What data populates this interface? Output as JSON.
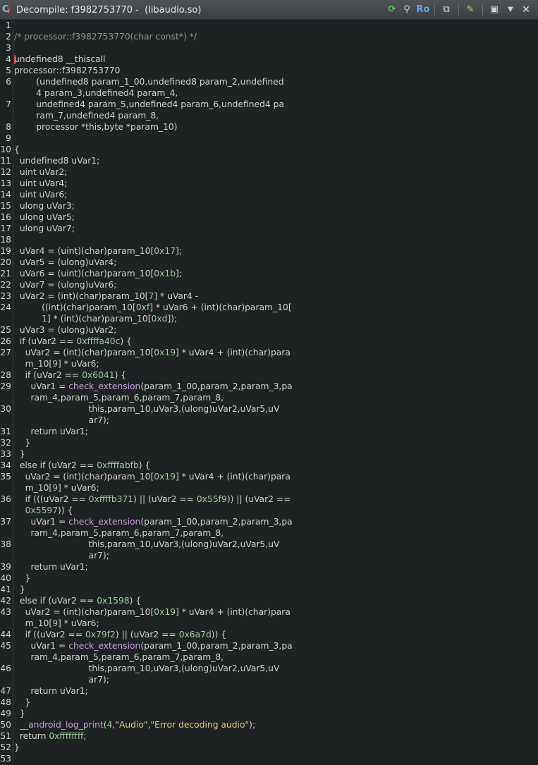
{
  "window": {
    "title": "Decompile: f3982753770 -  (libaudio.so)",
    "icon_name": "decompiler-icon",
    "accent": "#8fb6e8"
  },
  "toolbar": {
    "buttons": [
      {
        "name": "refresh-icon",
        "glyph": "⟳",
        "color": "#5fc05f"
      },
      {
        "name": "graph-icon",
        "glyph": "⚲",
        "color": "#d0d0d0"
      },
      {
        "name": "read-only-button",
        "glyph": "Ro",
        "color": "#6aa0e8"
      },
      {
        "name": "copy-icon",
        "glyph": "⧉",
        "color": "#e0e0e0"
      },
      {
        "name": "edit-icon",
        "glyph": "✎",
        "color": "#e0c060"
      },
      {
        "name": "snapshot-icon",
        "glyph": "▣",
        "color": "#cfcfcf"
      },
      {
        "name": "menu-dropdown-icon",
        "glyph": "▼",
        "color": "#cfcfcf"
      },
      {
        "name": "close-icon",
        "glyph": "✕",
        "color": "#e0e0e0"
      }
    ]
  },
  "code_lines": [
    {
      "n": "1",
      "segs": []
    },
    {
      "n": "2",
      "segs": [
        [
          "cm",
          "/* processor::f3982753770(char const*) */"
        ]
      ]
    },
    {
      "n": "3",
      "segs": []
    },
    {
      "n": "4",
      "segs": [
        [
          "t",
          "undefined8 __thiscall"
        ]
      ],
      "cursor": true
    },
    {
      "n": "5",
      "segs": [
        [
          "t",
          "processor::f3982753770"
        ]
      ]
    },
    {
      "n": "6",
      "segs": [
        [
          "t",
          "        (undefined8 param_1_00,undefined8 param_2,undefined"
        ]
      ]
    },
    {
      "n": "",
      "segs": [
        [
          "t",
          "        4 param_3,undefined4 param_4,"
        ]
      ]
    },
    {
      "n": "7",
      "segs": [
        [
          "t",
          "        undefined4 param_5,undefined4 param_6,undefined4 pa"
        ]
      ]
    },
    {
      "n": "",
      "segs": [
        [
          "t",
          "        ram_7,undefined4 param_8,"
        ]
      ]
    },
    {
      "n": "8",
      "segs": [
        [
          "t",
          "        processor *this,byte *param_10)"
        ]
      ]
    },
    {
      "n": "9",
      "segs": []
    },
    {
      "n": "10",
      "segs": [
        [
          "t",
          "{"
        ]
      ]
    },
    {
      "n": "11",
      "segs": [
        [
          "t",
          "  undefined8 uVar1;"
        ]
      ]
    },
    {
      "n": "12",
      "segs": [
        [
          "t",
          "  uint uVar2;"
        ]
      ]
    },
    {
      "n": "13",
      "segs": [
        [
          "t",
          "  uint uVar4;"
        ]
      ]
    },
    {
      "n": "14",
      "segs": [
        [
          "t",
          "  uint uVar6;"
        ]
      ]
    },
    {
      "n": "15",
      "segs": [
        [
          "t",
          "  ulong uVar3;"
        ]
      ]
    },
    {
      "n": "16",
      "segs": [
        [
          "t",
          "  ulong uVar5;"
        ]
      ]
    },
    {
      "n": "17",
      "segs": [
        [
          "t",
          "  ulong uVar7;"
        ]
      ]
    },
    {
      "n": "18",
      "segs": []
    },
    {
      "n": "19",
      "segs": [
        [
          "t",
          "  uVar4 = (uint)(char)param_10["
        ],
        [
          "num",
          "0x17"
        ],
        [
          "t",
          "];"
        ]
      ]
    },
    {
      "n": "20",
      "segs": [
        [
          "t",
          "  uVar5 = (ulong)uVar4;"
        ]
      ]
    },
    {
      "n": "21",
      "segs": [
        [
          "t",
          "  uVar6 = (uint)(char)param_10["
        ],
        [
          "num",
          "0x1b"
        ],
        [
          "t",
          "];"
        ]
      ]
    },
    {
      "n": "22",
      "segs": [
        [
          "t",
          "  uVar7 = (ulong)uVar6;"
        ]
      ]
    },
    {
      "n": "23",
      "segs": [
        [
          "t",
          "  uVar2 = (int)(char)param_10["
        ],
        [
          "num",
          "7"
        ],
        [
          "t",
          "] * uVar4 -"
        ]
      ]
    },
    {
      "n": "24",
      "segs": [
        [
          "t",
          "          ((int)(char)param_10["
        ],
        [
          "num",
          "0xf"
        ],
        [
          "t",
          "] * uVar6 + (int)(char)param_10["
        ]
      ]
    },
    {
      "n": "",
      "segs": [
        [
          "t",
          "          "
        ],
        [
          "num",
          "1"
        ],
        [
          "t",
          "] * (int)(char)param_10["
        ],
        [
          "num",
          "0xd"
        ],
        [
          "t",
          "]);"
        ]
      ]
    },
    {
      "n": "25",
      "segs": [
        [
          "t",
          "  uVar3 = (ulong)uVar2;"
        ]
      ]
    },
    {
      "n": "26",
      "segs": [
        [
          "t",
          "  if (uVar2 == "
        ],
        [
          "num",
          "0xffffa40c"
        ],
        [
          "t",
          ") {"
        ]
      ]
    },
    {
      "n": "27",
      "segs": [
        [
          "t",
          "    uVar2 = (int)(char)param_10["
        ],
        [
          "num",
          "0x19"
        ],
        [
          "t",
          "] * uVar4 + (int)(char)para"
        ]
      ]
    },
    {
      "n": "",
      "segs": [
        [
          "t",
          "    m_10["
        ],
        [
          "num",
          "9"
        ],
        [
          "t",
          "] * uVar6;"
        ]
      ]
    },
    {
      "n": "28",
      "segs": [
        [
          "t",
          "    if (uVar2 == "
        ],
        [
          "num",
          "0x6041"
        ],
        [
          "t",
          ") {"
        ]
      ]
    },
    {
      "n": "29",
      "segs": [
        [
          "t",
          "      uVar1 = "
        ],
        [
          "fn",
          "check_extension"
        ],
        [
          "t",
          "(param_1_00,param_2,param_3,pa"
        ]
      ]
    },
    {
      "n": "",
      "segs": [
        [
          "t",
          "      ram_4,param_5,param_6,param_7,param_8,"
        ]
      ]
    },
    {
      "n": "30",
      "segs": [
        [
          "t",
          "                           this,param_10,uVar3,(ulong)uVar2,uVar5,uV"
        ]
      ]
    },
    {
      "n": "",
      "segs": [
        [
          "t",
          "                           ar7);"
        ]
      ]
    },
    {
      "n": "31",
      "segs": [
        [
          "t",
          "      return uVar1;"
        ]
      ]
    },
    {
      "n": "32",
      "segs": [
        [
          "t",
          "    }"
        ]
      ]
    },
    {
      "n": "33",
      "segs": [
        [
          "t",
          "  }"
        ]
      ]
    },
    {
      "n": "34",
      "segs": [
        [
          "t",
          "  else if (uVar2 == "
        ],
        [
          "num",
          "0xffffabfb"
        ],
        [
          "t",
          ") {"
        ]
      ]
    },
    {
      "n": "35",
      "segs": [
        [
          "t",
          "    uVar2 = (int)(char)param_10["
        ],
        [
          "num",
          "0x19"
        ],
        [
          "t",
          "] * uVar4 + (int)(char)para"
        ]
      ]
    },
    {
      "n": "",
      "segs": [
        [
          "t",
          "    m_10["
        ],
        [
          "num",
          "9"
        ],
        [
          "t",
          "] * uVar6;"
        ]
      ]
    },
    {
      "n": "36",
      "segs": [
        [
          "t",
          "    if (((uVar2 == "
        ],
        [
          "num",
          "0xffffb371"
        ],
        [
          "t",
          ") || (uVar2 == "
        ],
        [
          "num",
          "0x55f9"
        ],
        [
          "t",
          ")) || (uVar2 =="
        ]
      ]
    },
    {
      "n": "",
      "segs": [
        [
          "t",
          "    "
        ],
        [
          "num",
          "0x5597"
        ],
        [
          "t",
          ")) {"
        ]
      ]
    },
    {
      "n": "37",
      "segs": [
        [
          "t",
          "      uVar1 = "
        ],
        [
          "fn",
          "check_extension"
        ],
        [
          "t",
          "(param_1_00,param_2,param_3,pa"
        ]
      ]
    },
    {
      "n": "",
      "segs": [
        [
          "t",
          "      ram_4,param_5,param_6,param_7,param_8,"
        ]
      ]
    },
    {
      "n": "38",
      "segs": [
        [
          "t",
          "                           this,param_10,uVar3,(ulong)uVar2,uVar5,uV"
        ]
      ]
    },
    {
      "n": "",
      "segs": [
        [
          "t",
          "                           ar7);"
        ]
      ]
    },
    {
      "n": "39",
      "segs": [
        [
          "t",
          "      return uVar1;"
        ]
      ]
    },
    {
      "n": "40",
      "segs": [
        [
          "t",
          "    }"
        ]
      ]
    },
    {
      "n": "41",
      "segs": [
        [
          "t",
          "  }"
        ]
      ]
    },
    {
      "n": "42",
      "segs": [
        [
          "t",
          "  else if (uVar2 == "
        ],
        [
          "num",
          "0x1598"
        ],
        [
          "t",
          ") {"
        ]
      ]
    },
    {
      "n": "43",
      "segs": [
        [
          "t",
          "    uVar2 = (int)(char)param_10["
        ],
        [
          "num",
          "0x19"
        ],
        [
          "t",
          "] * uVar4 + (int)(char)para"
        ]
      ]
    },
    {
      "n": "",
      "segs": [
        [
          "t",
          "    m_10["
        ],
        [
          "num",
          "9"
        ],
        [
          "t",
          "] * uVar6;"
        ]
      ]
    },
    {
      "n": "44",
      "segs": [
        [
          "t",
          "    if ((uVar2 == "
        ],
        [
          "num",
          "0x79f2"
        ],
        [
          "t",
          ") || (uVar2 == "
        ],
        [
          "num",
          "0x6a7d"
        ],
        [
          "t",
          ")) {"
        ]
      ]
    },
    {
      "n": "45",
      "segs": [
        [
          "t",
          "      uVar1 = "
        ],
        [
          "fn",
          "check_extension"
        ],
        [
          "t",
          "(param_1_00,param_2,param_3,pa"
        ]
      ]
    },
    {
      "n": "",
      "segs": [
        [
          "t",
          "      ram_4,param_5,param_6,param_7,param_8,"
        ]
      ]
    },
    {
      "n": "46",
      "segs": [
        [
          "t",
          "                           this,param_10,uVar3,(ulong)uVar2,uVar5,uV"
        ]
      ]
    },
    {
      "n": "",
      "segs": [
        [
          "t",
          "                           ar7);"
        ]
      ]
    },
    {
      "n": "47",
      "segs": [
        [
          "t",
          "      return uVar1;"
        ]
      ]
    },
    {
      "n": "48",
      "segs": [
        [
          "t",
          "    }"
        ]
      ]
    },
    {
      "n": "49",
      "segs": [
        [
          "t",
          "  }"
        ]
      ]
    },
    {
      "n": "50",
      "segs": [
        [
          "t",
          "  "
        ],
        [
          "fn",
          "__android_log_print"
        ],
        [
          "t",
          "("
        ],
        [
          "num",
          "4"
        ],
        [
          "t",
          ","
        ],
        [
          "str",
          "\"Audio\""
        ],
        [
          "t",
          ","
        ],
        [
          "str",
          "\"Error decoding audio\""
        ],
        [
          "t",
          ");"
        ]
      ]
    },
    {
      "n": "51",
      "segs": [
        [
          "t",
          "  return "
        ],
        [
          "num",
          "0xffffffff"
        ],
        [
          "t",
          ";"
        ]
      ]
    },
    {
      "n": "52",
      "segs": [
        [
          "t",
          "}"
        ]
      ]
    },
    {
      "n": "53",
      "segs": []
    }
  ]
}
